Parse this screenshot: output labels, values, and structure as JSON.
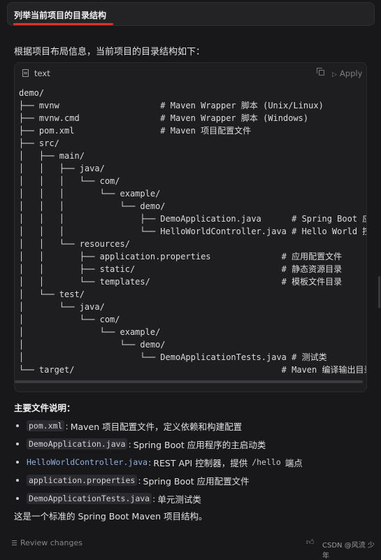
{
  "prompt_tab": {
    "label": "列举当前项目的目录结构"
  },
  "intro": "根据项目布局信息，当前项目的目录结构如下：",
  "code_block": {
    "language": "text",
    "apply_label": "Apply",
    "content": "demo/\n├── mvnw                    # Maven Wrapper 脚本 (Unix/Linux)\n├── mvnw.cmd                # Maven Wrapper 脚本 (Windows)\n├── pom.xml                 # Maven 项目配置文件\n├── src/\n│   ├── main/\n│   │   ├── java/\n│   │   │   └── com/\n│   │   │       └── example/\n│   │   │           └── demo/\n│   │   │               ├── DemoApplication.java      # Spring Boot 应用主类\n│   │   │               └── HelloWorldController.java # Hello World 控制器\n│   │   └── resources/\n│   │       ├── application.properties              # 应用配置文件\n│   │       ├── static/                             # 静态资源目录\n│   │       └── templates/                          # 模板文件目录\n│   └── test/\n│       └── java/\n│           └── com/\n│               └── example/\n│                   └── demo/\n│                       └── DemoApplicationTests.java # 测试类\n└── target/                                         # Maven 编译输出目录"
  },
  "files_title": "主要文件说明：",
  "files": [
    {
      "name": "pom.xml",
      "sep": ":",
      "desc": "Maven 项目配置文件，定义依赖和构建配置"
    },
    {
      "name": "DemoApplication.java",
      "sep": ":",
      "desc": "Spring Boot 应用程序的主启动类"
    },
    {
      "name": "HelloWorldController.java",
      "sep": ":",
      "desc": "REST API 控制器，提供",
      "code": "/hello",
      "desc_after": "端点"
    },
    {
      "name": "application.properties",
      "sep": ":",
      "desc": "Spring Boot 应用配置文件"
    },
    {
      "name": "DemoApplicationTests.java",
      "sep": ":",
      "desc": "单元测试类"
    }
  ],
  "summary": "这是一个标准的 Spring Boot Maven 项目结构。",
  "footer": {
    "review_label": "Review changes",
    "watermark": "CSDN @风流 少年"
  },
  "colors": {
    "accent_underline": "#e0302a",
    "link": "#8fb3e0",
    "background": "#18181a"
  }
}
